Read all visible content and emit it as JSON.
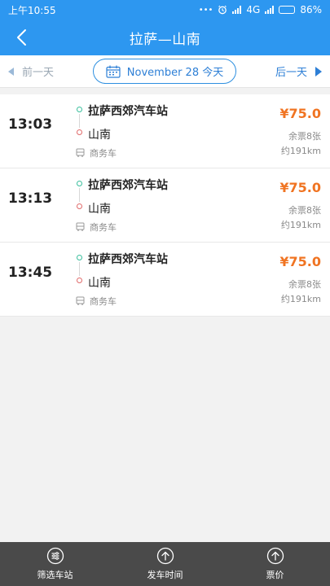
{
  "status_bar": {
    "time": "上午10:55",
    "dots": "•••",
    "network": "4G",
    "battery_text": "86%",
    "battery_level": 0.86
  },
  "header": {
    "title": "拉萨—山南"
  },
  "date_bar": {
    "prev_label": "前一天",
    "date_label": "November  28 今天",
    "next_label": "后一天"
  },
  "trips": [
    {
      "time": "13:03",
      "from": "拉萨西郊汽车站",
      "to": "山南",
      "bus_type": "商务车",
      "price": "¥75.0",
      "tickets": "余票8张",
      "distance": "约191km"
    },
    {
      "time": "13:13",
      "from": "拉萨西郊汽车站",
      "to": "山南",
      "bus_type": "商务车",
      "price": "¥75.0",
      "tickets": "余票8张",
      "distance": "约191km"
    },
    {
      "time": "13:45",
      "from": "拉萨西郊汽车站",
      "to": "山南",
      "bus_type": "商务车",
      "price": "¥75.0",
      "tickets": "余票8张",
      "distance": "约191km"
    }
  ],
  "bottom_tabs": [
    {
      "label": "筛选车站",
      "icon": "filter-icon"
    },
    {
      "label": "发车时间",
      "icon": "up-circle-icon"
    },
    {
      "label": "票价",
      "icon": "up-circle-icon"
    }
  ],
  "colors": {
    "primary": "#2d97f0",
    "price": "#f07422",
    "bottom_bar": "#4a4a4a"
  }
}
